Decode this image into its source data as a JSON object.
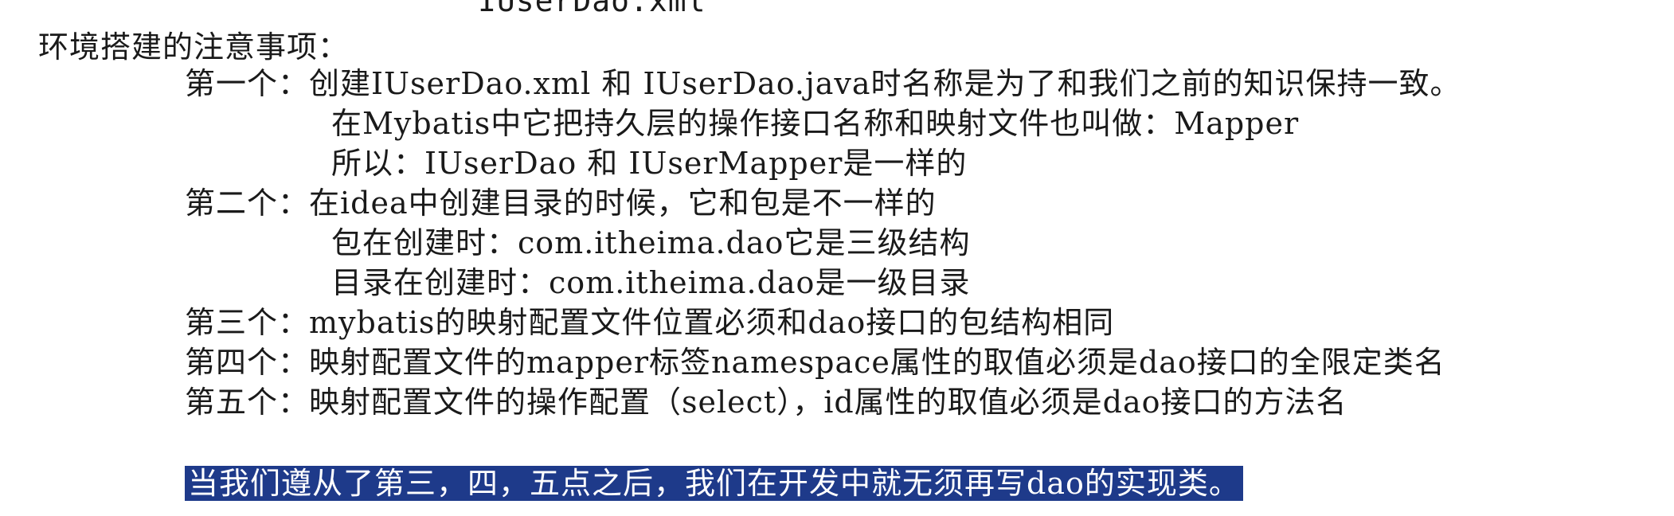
{
  "top_text": "IUserDao.xml",
  "heading": "环境搭建的注意事项：",
  "items": [
    {
      "label": "第一个：",
      "text": "创建IUserDao.xml 和 IUserDao.java时名称是为了和我们之前的知识保持一致。",
      "sub": [
        "在Mybatis中它把持久层的操作接口名称和映射文件也叫做：Mapper",
        "所以：IUserDao 和 IUserMapper是一样的"
      ]
    },
    {
      "label": "第二个：",
      "text": "在idea中创建目录的时候，它和包是不一样的",
      "sub": [
        "包在创建时：com.itheima.dao它是三级结构",
        "目录在创建时：com.itheima.dao是一级目录"
      ]
    },
    {
      "label": "第三个：",
      "text": "mybatis的映射配置文件位置必须和dao接口的包结构相同"
    },
    {
      "label": "第四个：",
      "text": "映射配置文件的mapper标签namespace属性的取值必须是dao接口的全限定类名"
    },
    {
      "label": "第五个：",
      "text": "映射配置文件的操作配置（select），id属性的取值必须是dao接口的方法名"
    }
  ],
  "conclusion": "当我们遵从了第三，四，五点之后，我们在开发中就无须再写dao的实现类。"
}
